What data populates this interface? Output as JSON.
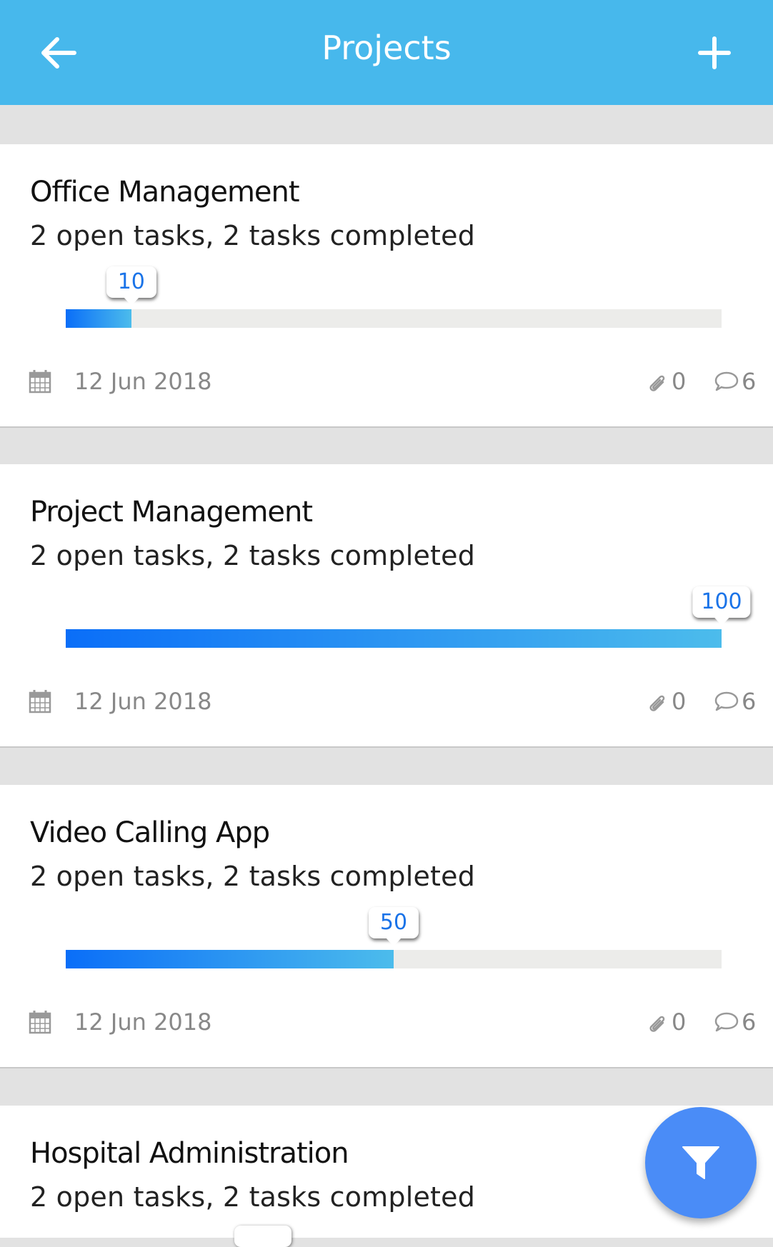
{
  "appbar": {
    "title": "Projects",
    "back_icon": "arrow-left-icon",
    "add_icon": "plus-icon",
    "color": "#47b8ec"
  },
  "projects": [
    {
      "name": "Office Management",
      "tasks": "2 open tasks, 2 tasks completed",
      "progress": 10,
      "progress_label": "10",
      "date": "12 Jun 2018",
      "attachments": "0",
      "comments": "6"
    },
    {
      "name": "Project Management",
      "tasks": "2 open tasks, 2 tasks completed",
      "progress": 100,
      "progress_label": "100",
      "date": "12 Jun 2018",
      "attachments": "0",
      "comments": "6"
    },
    {
      "name": "Video Calling App",
      "tasks": "2 open tasks, 2 tasks completed",
      "progress": 50,
      "progress_label": "50",
      "date": "12 Jun 2018",
      "attachments": "0",
      "comments": "6"
    },
    {
      "name": "Hospital Administration",
      "tasks": "2 open tasks, 2 tasks completed"
    }
  ],
  "fab": {
    "icon": "filter-icon",
    "color": "#4a8cf7"
  },
  "colors": {
    "progress_start": "#0a6ef8",
    "progress_end": "#4cbcec",
    "bubble_text": "#1a73e8",
    "meta_text": "#888888"
  }
}
